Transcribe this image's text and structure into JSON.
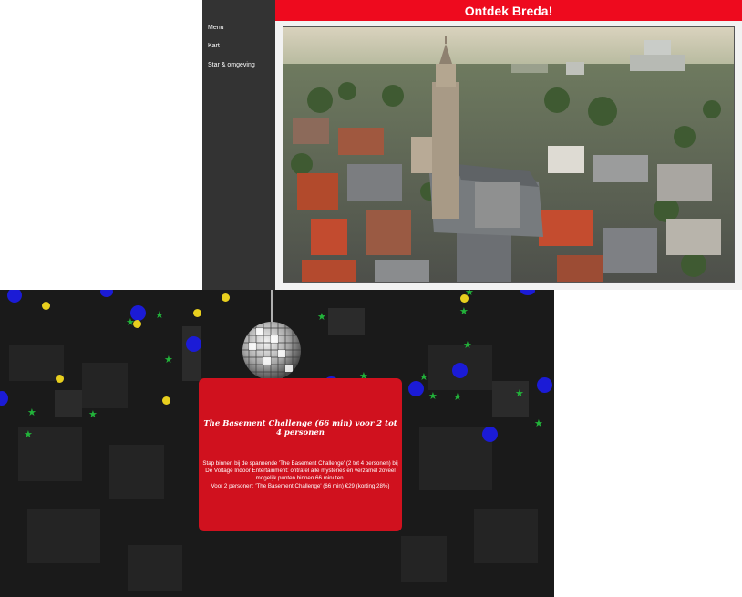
{
  "header": {
    "title": "Ontdek Breda!"
  },
  "sidebar": {
    "items": [
      {
        "label": "Menu"
      },
      {
        "label": "Kart"
      },
      {
        "label": "Star & omgeving"
      }
    ]
  },
  "card": {
    "title": "The Basement Challenge (66 min) voor 2 tot 4 personen",
    "body_line1": "Stap binnen bij de spannende 'The Basement Challenge' (2 tot 4 personen) bij De Voltage Indoor Entertainment: ontrafel alle mysteries en verzamel zoveel mogelijk punten binnen 66 minuten.",
    "body_line2": "Voor 2 personen: 'The Basement Challenge' (66 min) €29 (korting 28%)"
  },
  "colors": {
    "header_red": "#ee0a1e",
    "sidebar_bg": "#333333",
    "card_red": "#d0111e",
    "confetti_blue": "#1b1bd6",
    "confetti_yellow": "#e8cf1e",
    "confetti_green": "#22b33a"
  },
  "icons": {
    "disco_ball": "disco-ball-icon",
    "confetti_star": "star-icon"
  }
}
